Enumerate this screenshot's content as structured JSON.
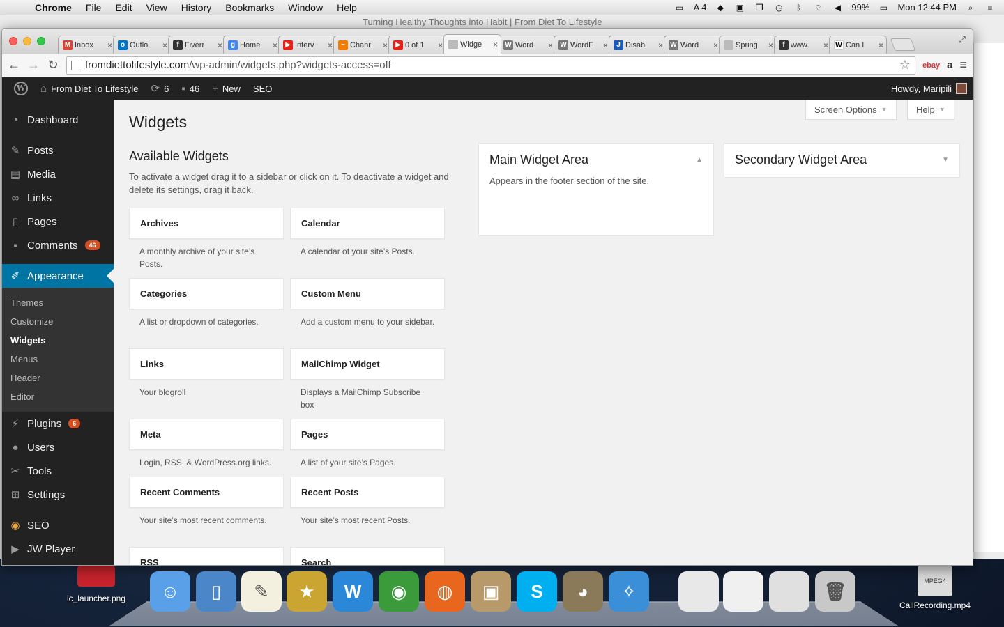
{
  "menubar": {
    "app": "Chrome",
    "items": [
      "File",
      "Edit",
      "View",
      "History",
      "Bookmarks",
      "Window",
      "Help"
    ],
    "adobe_count": "4",
    "battery": "99%",
    "clock": "Mon 12:44 PM"
  },
  "background_window_title": "Turning Healthy Thoughts into Habit | From Diet To Lifestyle",
  "browser": {
    "tabs": [
      {
        "label": "Inbox",
        "icon": "gmail-icon",
        "color": "#d44638",
        "glyph": "M"
      },
      {
        "label": "Outlo",
        "icon": "outlook-icon",
        "color": "#0072c6",
        "glyph": "o"
      },
      {
        "label": "Fiverr",
        "icon": "fiverr-icon",
        "color": "#333333",
        "glyph": "f"
      },
      {
        "label": "Home",
        "icon": "google-plus-icon",
        "color": "#4285f4",
        "glyph": "g"
      },
      {
        "label": "Interv",
        "icon": "youtube-icon",
        "color": "#e62117",
        "glyph": "▶"
      },
      {
        "label": "Chanr",
        "icon": "chart-icon",
        "color": "#f57c00",
        "glyph": "~"
      },
      {
        "label": "0 of 1",
        "icon": "youtube-icon",
        "color": "#e62117",
        "glyph": "▶"
      },
      {
        "label": "Widge",
        "icon": "page-icon",
        "color": "#bbbbbb",
        "glyph": "",
        "active": true
      },
      {
        "label": "Word",
        "icon": "wordpress-icon",
        "color": "#777777",
        "glyph": "W"
      },
      {
        "label": "WordF",
        "icon": "wordpress-icon",
        "color": "#777777",
        "glyph": "W"
      },
      {
        "label": "Disab",
        "icon": "joomla-icon",
        "color": "#1f5bb0",
        "glyph": "J"
      },
      {
        "label": "Word",
        "icon": "wordpress-icon",
        "color": "#777777",
        "glyph": "W"
      },
      {
        "label": "Spring",
        "icon": "page-icon",
        "color": "#bbbbbb",
        "glyph": ""
      },
      {
        "label": "www.",
        "icon": "fiverr-icon",
        "color": "#333333",
        "glyph": "f"
      },
      {
        "label": "Can I",
        "icon": "wikipedia-icon",
        "color": "#ffffff",
        "glyph": "W"
      }
    ],
    "url_host": "fromdiettolifestyle.com",
    "url_path": "/wp-admin/widgets.php?widgets-access=off",
    "ext_ebay": "ebay",
    "ext_amazon": "a"
  },
  "adminbar": {
    "site_name": "From Diet To Lifestyle",
    "updates": "6",
    "comments": "46",
    "new_label": "New",
    "seo_label": "SEO",
    "howdy": "Howdy, Maripili"
  },
  "sidebar": {
    "dashboard": "Dashboard",
    "posts": "Posts",
    "media": "Media",
    "links": "Links",
    "pages": "Pages",
    "comments": "Comments",
    "comments_count": "46",
    "appearance": "Appearance",
    "sub": [
      "Themes",
      "Customize",
      "Widgets",
      "Menus",
      "Header",
      "Editor"
    ],
    "plugins": "Plugins",
    "plugins_count": "6",
    "users": "Users",
    "tools": "Tools",
    "settings": "Settings",
    "seo": "SEO",
    "jwplayer": "JW Player"
  },
  "page": {
    "screen_options": "Screen Options",
    "help": "Help",
    "title": "Widgets",
    "available_heading": "Available Widgets",
    "available_desc": "To activate a widget drag it to a sidebar or click on it. To deactivate a widget and delete its settings, drag it back.",
    "widgets": [
      {
        "name": "Archives",
        "desc": "A monthly archive of your site’s Posts."
      },
      {
        "name": "Calendar",
        "desc": "A calendar of your site’s Posts."
      },
      {
        "name": "Categories",
        "desc": "A list or dropdown of categories."
      },
      {
        "name": "Custom Menu",
        "desc": "Add a custom menu to your sidebar."
      },
      {
        "name": "Links",
        "desc": "Your blogroll"
      },
      {
        "name": "MailChimp Widget",
        "desc": "Displays a MailChimp Subscribe box"
      },
      {
        "name": "Meta",
        "desc": "Login, RSS, & WordPress.org links."
      },
      {
        "name": "Pages",
        "desc": "A list of your site’s Pages."
      },
      {
        "name": "Recent Comments",
        "desc": "Your site’s most recent comments."
      },
      {
        "name": "Recent Posts",
        "desc": "Your site’s most recent Posts."
      },
      {
        "name": "RSS",
        "desc": ""
      },
      {
        "name": "Search",
        "desc": ""
      }
    ],
    "main_area": {
      "title": "Main Widget Area",
      "desc": "Appears in the footer section of the site."
    },
    "secondary_area": {
      "title": "Secondary Widget Area"
    }
  },
  "desktop": {
    "file1": "ic_launcher.png",
    "file2": "CallRecording.mp4"
  },
  "dock": [
    {
      "name": "finder-icon",
      "color": "#5aa0e8",
      "glyph": "☺"
    },
    {
      "name": "xcode-icon",
      "color": "#4a86c8",
      "glyph": "▯"
    },
    {
      "name": "textedit-icon",
      "color": "#f4f0e0",
      "glyph": "✎"
    },
    {
      "name": "imovie-icon",
      "color": "#caa532",
      "glyph": "★"
    },
    {
      "name": "wunderlist-icon",
      "color": "#2b88d9",
      "glyph": "W"
    },
    {
      "name": "chrome-icon",
      "color": "#3b9b3b",
      "glyph": "◉"
    },
    {
      "name": "firefox-icon",
      "color": "#e8661e",
      "glyph": "◍"
    },
    {
      "name": "photos-icon",
      "color": "#b89a6a",
      "glyph": "▣"
    },
    {
      "name": "skype-icon",
      "color": "#00aff0",
      "glyph": "S"
    },
    {
      "name": "gimp-icon",
      "color": "#8a7a5a",
      "glyph": "◕"
    },
    {
      "name": "safari-icon",
      "color": "#3a8fd8",
      "glyph": "✧"
    },
    {
      "name": "document-icon",
      "color": "#e8e8e8",
      "glyph": ""
    },
    {
      "name": "skype-window-icon",
      "color": "#f0f0f0",
      "glyph": ""
    },
    {
      "name": "spreadsheet-window-icon",
      "color": "#e0e0e0",
      "glyph": ""
    },
    {
      "name": "trash-icon",
      "color": "#c8c8c8",
      "glyph": "🗑"
    }
  ]
}
